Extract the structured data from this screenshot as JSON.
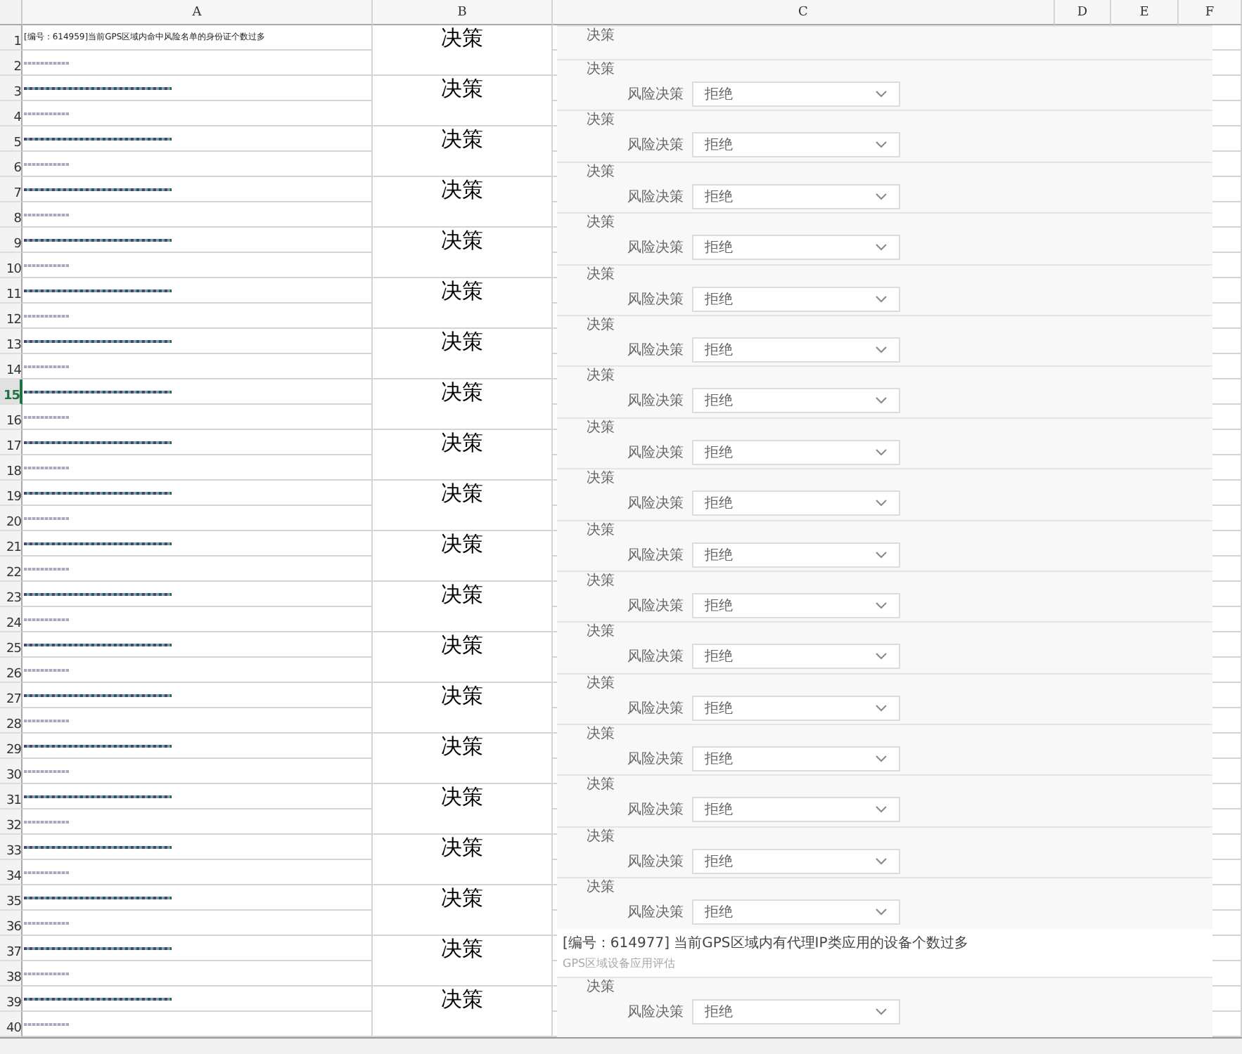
{
  "columns": [
    "A",
    "B",
    "C",
    "D",
    "E",
    "F"
  ],
  "rows": [
    {
      "number": "1",
      "selected": false,
      "cell_a": "[编号：614959]当前GPS区域内命中风险名单的身份证个数过多"
    },
    {
      "number": "2",
      "selected": false
    },
    {
      "number": "3",
      "selected": false
    },
    {
      "number": "4",
      "selected": false
    },
    {
      "number": "5",
      "selected": false
    },
    {
      "number": "6",
      "selected": false
    },
    {
      "number": "7",
      "selected": false
    },
    {
      "number": "8",
      "selected": false
    },
    {
      "number": "9",
      "selected": false
    },
    {
      "number": "10",
      "selected": false
    },
    {
      "number": "11",
      "selected": false
    },
    {
      "number": "12",
      "selected": false
    },
    {
      "number": "13",
      "selected": false
    },
    {
      "number": "14",
      "selected": false
    },
    {
      "number": "15",
      "selected": true
    },
    {
      "number": "16",
      "selected": false
    },
    {
      "number": "17",
      "selected": false
    },
    {
      "number": "18",
      "selected": false
    },
    {
      "number": "19",
      "selected": false
    },
    {
      "number": "20",
      "selected": false
    },
    {
      "number": "21",
      "selected": false
    },
    {
      "number": "22",
      "selected": false
    },
    {
      "number": "23",
      "selected": false
    },
    {
      "number": "24",
      "selected": false
    },
    {
      "number": "25",
      "selected": false
    },
    {
      "number": "26",
      "selected": false
    },
    {
      "number": "27",
      "selected": false
    },
    {
      "number": "28",
      "selected": false
    },
    {
      "number": "29",
      "selected": false
    },
    {
      "number": "30",
      "selected": false
    },
    {
      "number": "31",
      "selected": false
    },
    {
      "number": "32",
      "selected": false
    },
    {
      "number": "33",
      "selected": false
    },
    {
      "number": "34",
      "selected": false
    },
    {
      "number": "35",
      "selected": false
    },
    {
      "number": "36",
      "selected": false
    },
    {
      "number": "37",
      "selected": false
    },
    {
      "number": "38",
      "selected": false
    },
    {
      "number": "39",
      "selected": false
    },
    {
      "number": "40",
      "selected": false
    }
  ],
  "column_b": [
    "决策",
    "决策",
    "决策",
    "决策",
    "决策",
    "决策",
    "决策",
    "决策",
    "决策",
    "决策",
    "决策",
    "决策",
    "决策",
    "决策",
    "决策",
    "决策",
    "决策",
    "决策",
    "决策",
    "决策"
  ],
  "pasted_panels": [
    {
      "kind": "legend",
      "legend": "决策"
    },
    {
      "kind": "decision",
      "legend": "决策",
      "label": "风险决策",
      "value": "拒绝"
    },
    {
      "kind": "decision",
      "legend": "决策",
      "label": "风险决策",
      "value": "拒绝"
    },
    {
      "kind": "decision",
      "legend": "决策",
      "label": "风险决策",
      "value": "拒绝"
    },
    {
      "kind": "decision",
      "legend": "决策",
      "label": "风险决策",
      "value": "拒绝"
    },
    {
      "kind": "decision",
      "legend": "决策",
      "label": "风险决策",
      "value": "拒绝"
    },
    {
      "kind": "decision",
      "legend": "决策",
      "label": "风险决策",
      "value": "拒绝"
    },
    {
      "kind": "decision",
      "legend": "决策",
      "label": "风险决策",
      "value": "拒绝"
    },
    {
      "kind": "decision",
      "legend": "决策",
      "label": "风险决策",
      "value": "拒绝"
    },
    {
      "kind": "decision",
      "legend": "决策",
      "label": "风险决策",
      "value": "拒绝"
    },
    {
      "kind": "decision",
      "legend": "决策",
      "label": "风险决策",
      "value": "拒绝"
    },
    {
      "kind": "decision",
      "legend": "决策",
      "label": "风险决策",
      "value": "拒绝"
    },
    {
      "kind": "decision",
      "legend": "决策",
      "label": "风险决策",
      "value": "拒绝"
    },
    {
      "kind": "decision",
      "legend": "决策",
      "label": "风险决策",
      "value": "拒绝"
    },
    {
      "kind": "decision",
      "legend": "决策",
      "label": "风险决策",
      "value": "拒绝"
    },
    {
      "kind": "decision",
      "legend": "决策",
      "label": "风险决策",
      "value": "拒绝"
    },
    {
      "kind": "decision",
      "legend": "决策",
      "label": "风险决策",
      "value": "拒绝"
    },
    {
      "kind": "decision",
      "legend": "决策",
      "label": "风险决策",
      "value": "拒绝"
    },
    {
      "kind": "rule",
      "title": "[编号：614977]  当前GPS区域内有代理IP类应用的设备个数过多",
      "subtitle": "GPS区域设备应用评估"
    },
    {
      "kind": "decision",
      "legend": "决策",
      "label": "风险决策",
      "value": "拒绝"
    }
  ]
}
